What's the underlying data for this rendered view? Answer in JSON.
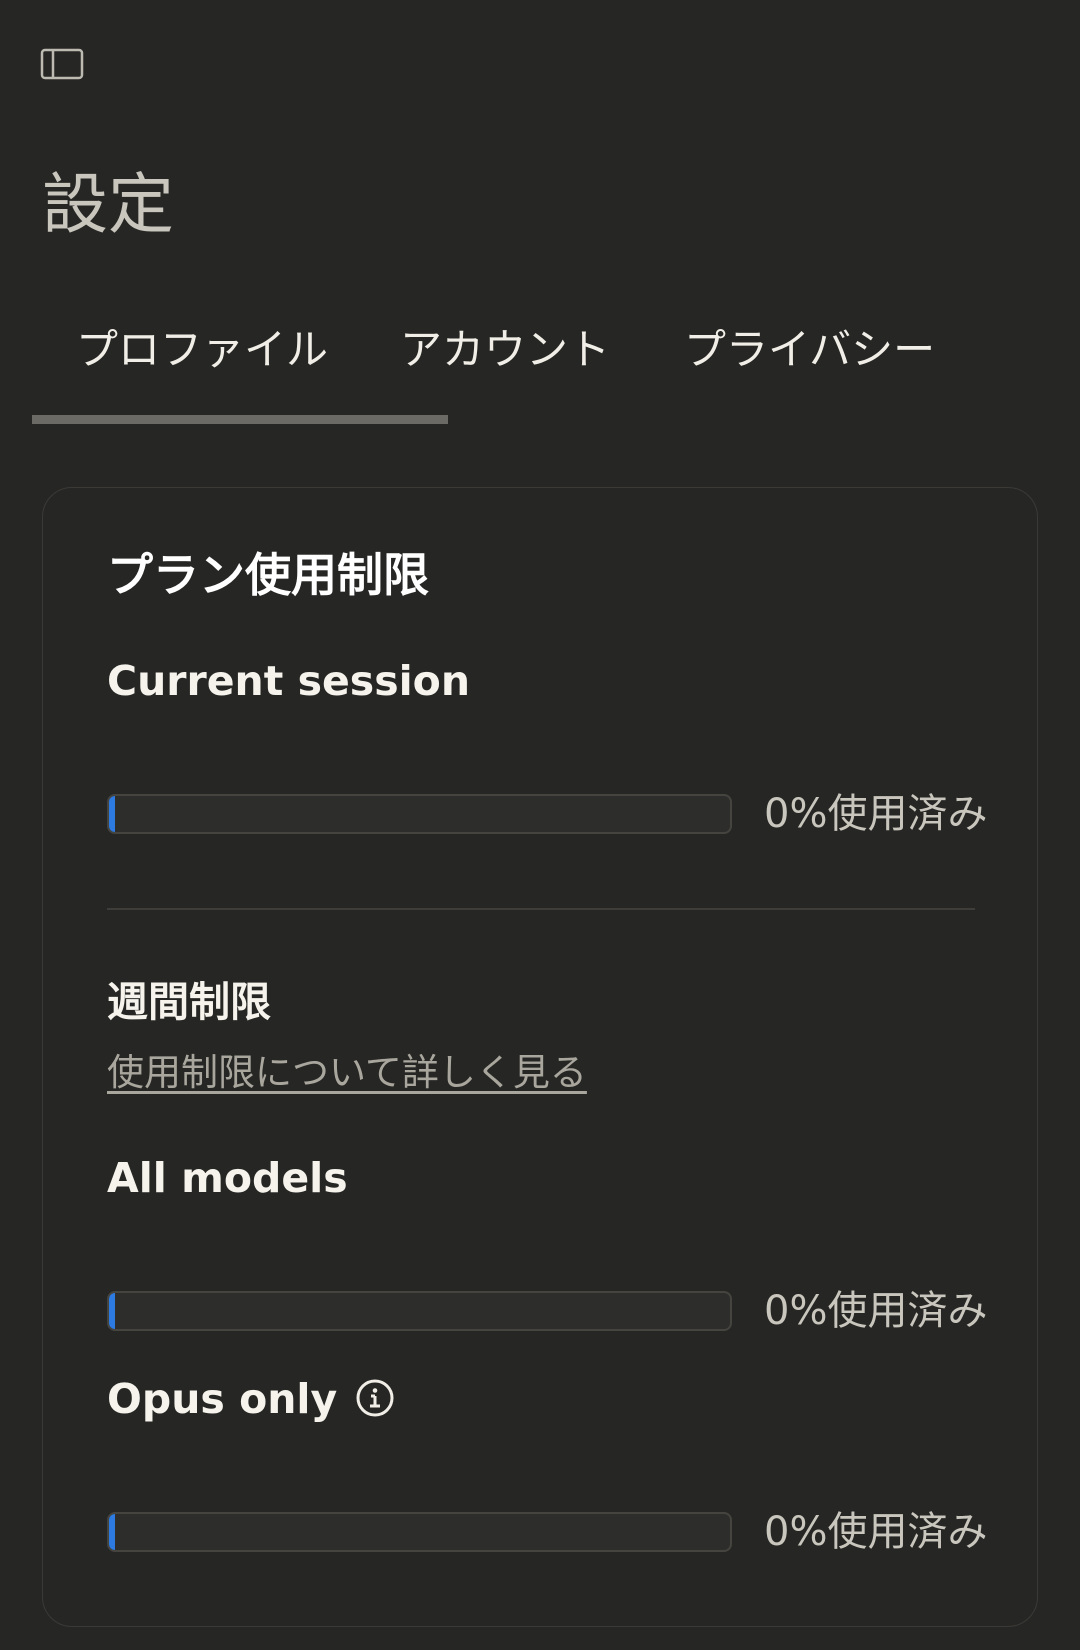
{
  "header": {
    "sidebar_toggle_icon": "sidebar-panel-icon",
    "title": "設定"
  },
  "tabs": [
    {
      "label": "プロファイル",
      "active": true
    },
    {
      "label": "アカウント",
      "active": false
    },
    {
      "label": "プライバシー",
      "active": false
    }
  ],
  "usage": {
    "title": "プラン使用制限",
    "current_session": {
      "label": "Current session",
      "percent": 0,
      "percent_text": "0%使用済み"
    },
    "weekly": {
      "title": "週間制限",
      "learn_more_link": "使用制限について詳しく見る"
    },
    "all_models": {
      "label": "All models",
      "percent": 0,
      "percent_text": "0%使用済み"
    },
    "opus_only": {
      "label": "Opus only",
      "info_icon": "info-icon",
      "percent": 0,
      "percent_text": "0%使用済み"
    }
  },
  "colors": {
    "background": "#262624",
    "bar_fill": "#2d7be0",
    "tab_indicator": "#6b6a65"
  }
}
